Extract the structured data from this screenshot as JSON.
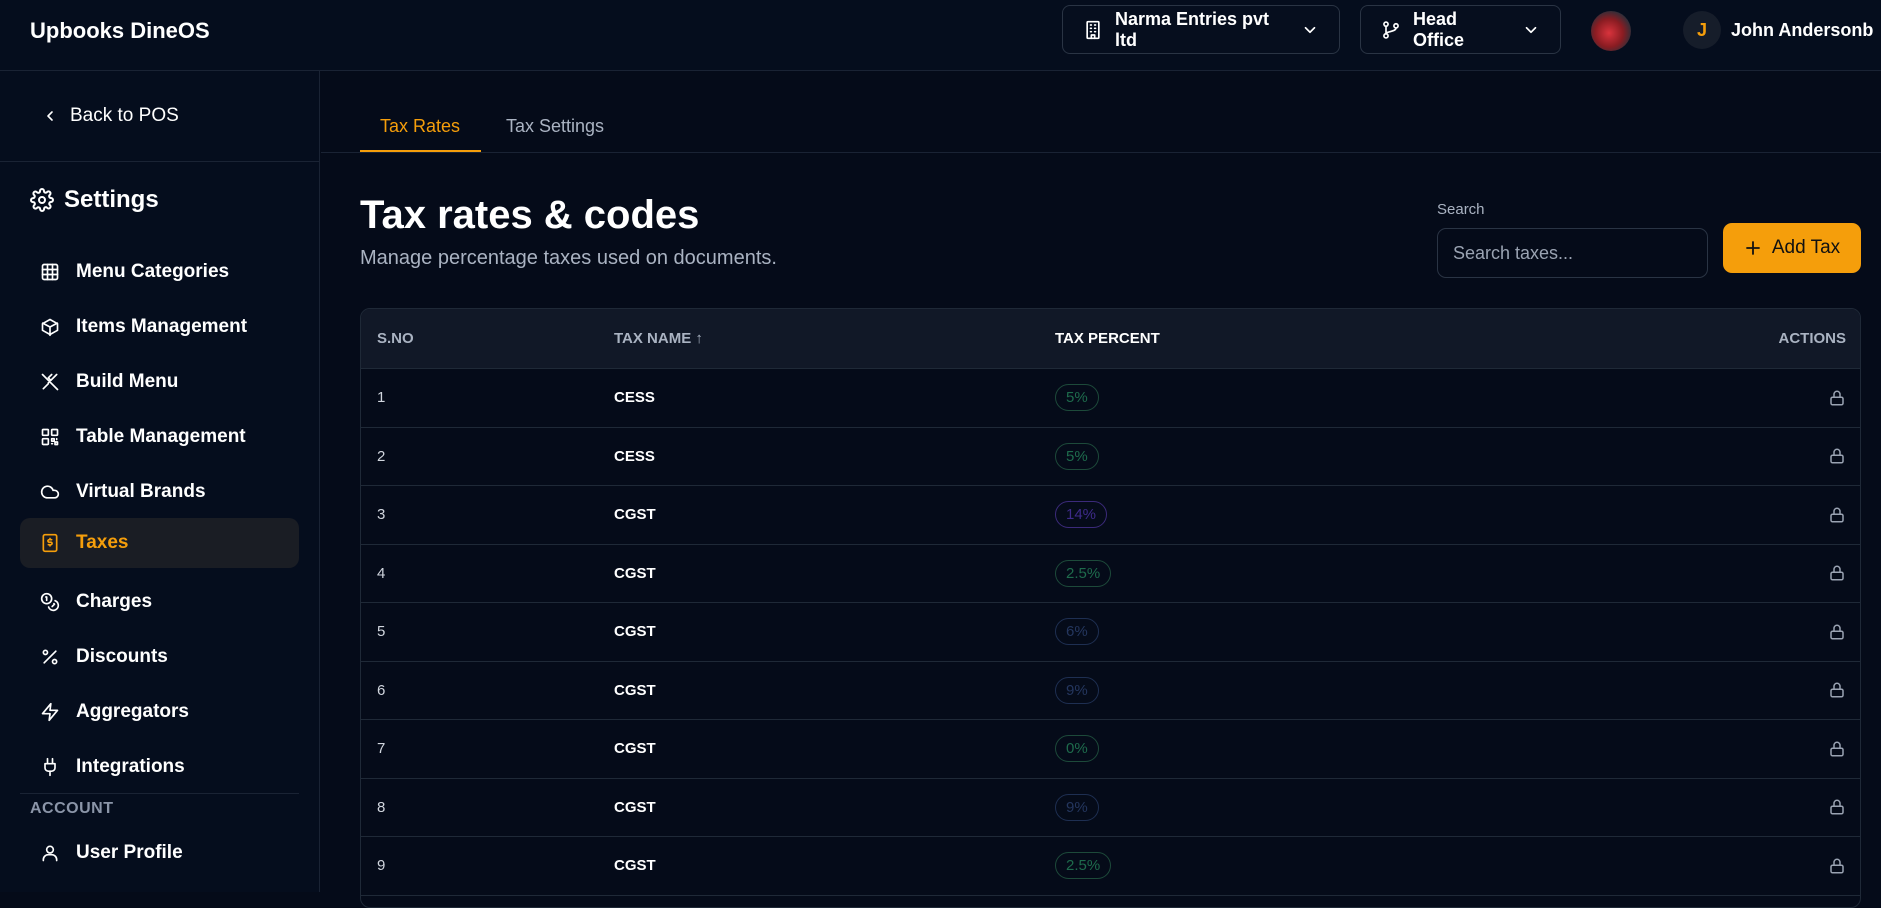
{
  "header": {
    "brand": "Upbooks DineOS",
    "company": "Narma Entries pvt ltd",
    "branch": "Head Office",
    "user_initial": "J",
    "user_name": "John Andersonb"
  },
  "sidebar": {
    "back_label": "Back to POS",
    "title": "Settings",
    "items": [
      {
        "label": "Menu Categories",
        "icon": "grid-icon"
      },
      {
        "label": "Items Management",
        "icon": "box-icon"
      },
      {
        "label": "Build Menu",
        "icon": "utensils-icon"
      },
      {
        "label": "Table Management",
        "icon": "qr-icon"
      },
      {
        "label": "Virtual Brands",
        "icon": "cloud-icon"
      },
      {
        "label": "Taxes",
        "icon": "receipt-icon",
        "active": true
      },
      {
        "label": "Charges",
        "icon": "coins-icon"
      },
      {
        "label": "Discounts",
        "icon": "percent-icon"
      },
      {
        "label": "Aggregators",
        "icon": "zap-icon"
      },
      {
        "label": "Integrations",
        "icon": "plug-icon"
      }
    ],
    "account_label": "ACCOUNT",
    "account_items": [
      {
        "label": "User Profile",
        "icon": "user-icon"
      }
    ]
  },
  "tabs": [
    {
      "label": "Tax Rates",
      "active": true
    },
    {
      "label": "Tax Settings",
      "active": false
    }
  ],
  "page": {
    "title": "Tax rates & codes",
    "subtitle": "Manage percentage taxes used on documents."
  },
  "search": {
    "label": "Search",
    "placeholder": "Search taxes..."
  },
  "add_button": "Add Tax",
  "table": {
    "headers": [
      "S.NO",
      "TAX NAME ↑",
      "TAX PERCENT",
      "ACTIONS"
    ],
    "rows": [
      {
        "sno": "1",
        "name": "CESS",
        "percent": "5%",
        "color": "green"
      },
      {
        "sno": "2",
        "name": "CESS",
        "percent": "5%",
        "color": "green"
      },
      {
        "sno": "3",
        "name": "CGST",
        "percent": "14%",
        "color": "purple"
      },
      {
        "sno": "4",
        "name": "CGST",
        "percent": "2.5%",
        "color": "green"
      },
      {
        "sno": "5",
        "name": "CGST",
        "percent": "6%",
        "color": "navy"
      },
      {
        "sno": "6",
        "name": "CGST",
        "percent": "9%",
        "color": "navy"
      },
      {
        "sno": "7",
        "name": "CGST",
        "percent": "0%",
        "color": "green"
      },
      {
        "sno": "8",
        "name": "CGST",
        "percent": "9%",
        "color": "navy"
      },
      {
        "sno": "9",
        "name": "CGST",
        "percent": "2.5%",
        "color": "green"
      }
    ]
  },
  "colors": {
    "accent": "#f59e0b",
    "background": "#050b19"
  }
}
